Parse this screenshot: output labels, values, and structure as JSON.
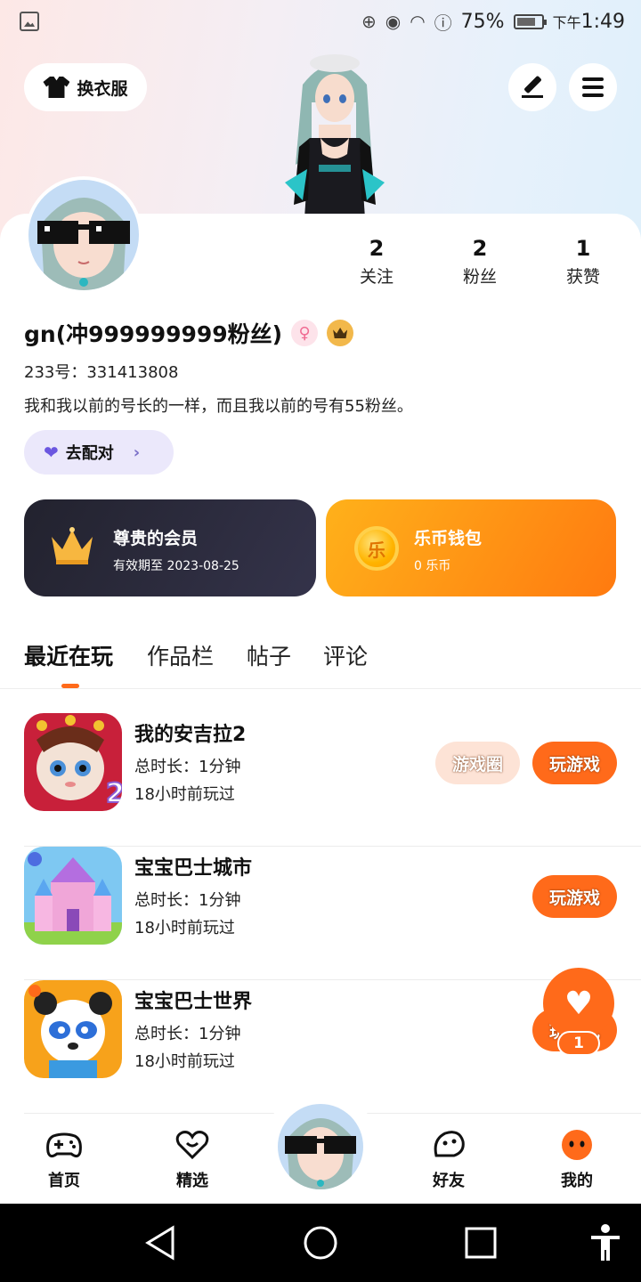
{
  "status_bar": {
    "battery": "75%",
    "time_prefix": "下午",
    "time": "1:49"
  },
  "header": {
    "dress_up_label": "换衣服"
  },
  "stats": [
    {
      "value": "2",
      "label": "关注"
    },
    {
      "value": "2",
      "label": "粉丝"
    },
    {
      "value": "1",
      "label": "获赞"
    }
  ],
  "profile": {
    "name": "gn(冲999999999粉丝)",
    "gender_symbol": "♀",
    "uid": "233号：331413808",
    "bio": "我和我以前的号长的一样，而且我以前的号有55粉丝。",
    "match_label": "去配对",
    "match_chevron": "›"
  },
  "vip_card": {
    "title": "尊贵的会员",
    "subtitle": "有效期至 2023-08-25"
  },
  "wallet_card": {
    "coin_glyph": "乐",
    "title": "乐币钱包",
    "subtitle": "0 乐币"
  },
  "tabs": [
    {
      "label": "最近在玩",
      "active": true
    },
    {
      "label": "作品栏",
      "active": false
    },
    {
      "label": "帖子",
      "active": false
    },
    {
      "label": "评论",
      "active": false
    }
  ],
  "games": [
    {
      "name": "我的安吉拉2",
      "duration": "总时长：1分钟",
      "last_played": "18小时前玩过",
      "circle_label": "游戏圈",
      "play_label": "玩游戏"
    },
    {
      "name": "宝宝巴士城市",
      "duration": "总时长：1分钟",
      "last_played": "18小时前玩过",
      "play_label": "玩游戏"
    },
    {
      "name": "宝宝巴士世界",
      "duration": "总时长：1分钟",
      "last_played": "18小时前玩过",
      "play_label": "玩游戏"
    }
  ],
  "like_fab": {
    "count": "1"
  },
  "bottom_nav": [
    {
      "label": "首页",
      "icon": "gamepad-icon"
    },
    {
      "label": "精选",
      "icon": "heart-icon"
    },
    {
      "label": "好友",
      "icon": "friend-face-icon"
    },
    {
      "label": "我的",
      "icon": "me-face-icon"
    }
  ],
  "colors": {
    "accent": "#ff6a1a",
    "vip_card": "#2a2a38",
    "wallet_card": "#ff9a10"
  }
}
